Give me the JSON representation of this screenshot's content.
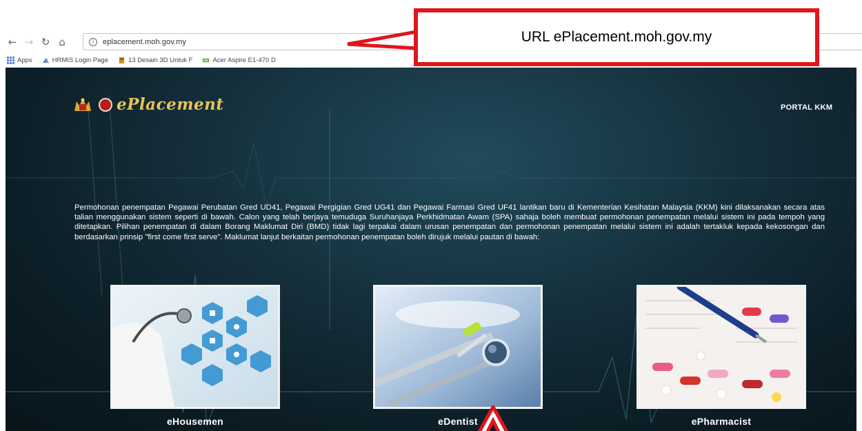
{
  "browser": {
    "url": "eplacement.moh.gov.my",
    "bookmarks": [
      {
        "label": "Apps"
      },
      {
        "label": "HRMIS Login Page"
      },
      {
        "label": "13 Desain 3D Untuk F"
      },
      {
        "label": "Acer Aspire E1-470 D"
      }
    ]
  },
  "site": {
    "brand": "ePlacement",
    "portal_link": "PORTAL KKM",
    "intro": "Permohonan penempatan Pegawai Perubatan Gred UD41, Pegawai Pergigian Gred UG41 dan Pegawai Farmasi Gred UF41 lantikan baru di Kementerian Kesihatan Malaysia (KKM) kini dilaksanakan secara atas talian menggunakan sistem seperti di bawah. Calon yang telah berjaya temuduga Suruhanjaya Perkhidmatan Awam (SPA) sahaja boleh membuat permohonan penempatan melalui sistem ini pada tempoh yang ditetapkan. Pilihan penempatan di dalam Borang Maklumat Diri (BMD) tidak lagi terpakai dalam urusan penempatan dan permohonan penempatan melalui sistem ini adalah tertakluk kepada kekosongan dan berdasarkan prinsip \"first come first serve\". Maklumat lanjut berkaitan permohonan penempatan boleh dirujuk melalui pautan di bawah:",
    "cards": [
      {
        "title": "eHousemen"
      },
      {
        "title": "eDentist"
      },
      {
        "title": "ePharmacist"
      }
    ]
  },
  "annotation": {
    "callout": "URL ePlacement.moh.gov.my",
    "color": "#e0161d"
  }
}
